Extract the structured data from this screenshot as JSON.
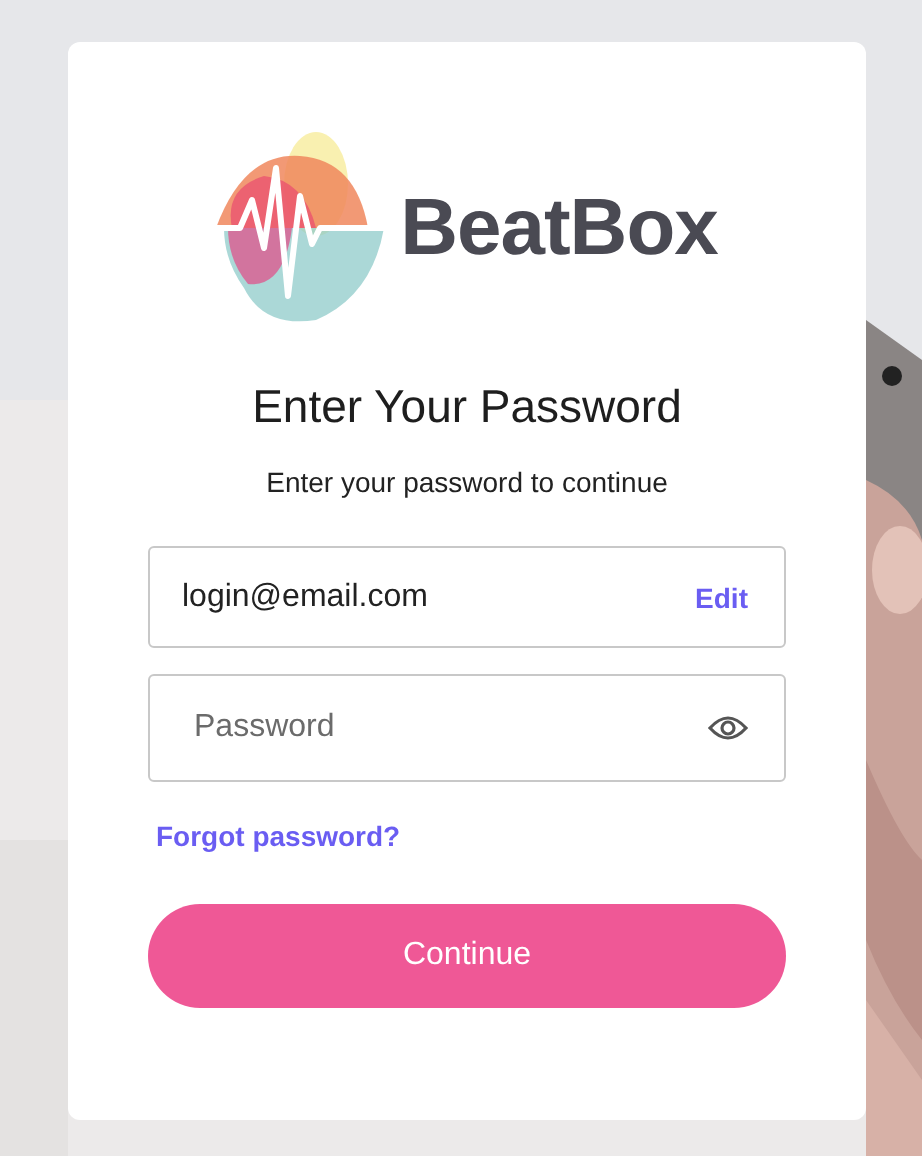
{
  "logo": {
    "text": "BeatBox"
  },
  "title": "Enter Your Password",
  "subtitle": "Enter your password to continue",
  "email_field": {
    "value": "login@email.com",
    "action": "Edit"
  },
  "password_field": {
    "placeholder": "Password"
  },
  "forgot_link": "Forgot password?",
  "continue_button": "Continue"
}
